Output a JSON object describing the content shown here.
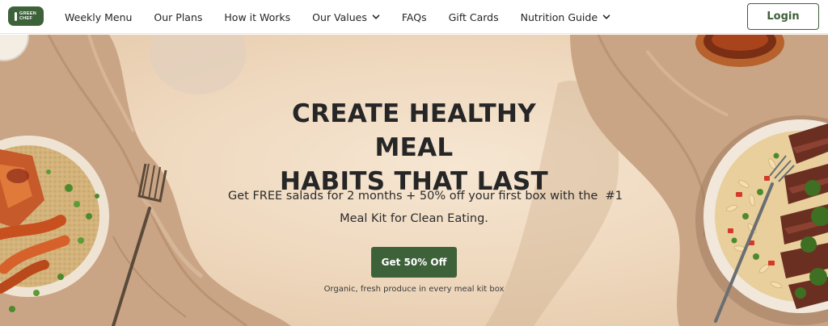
{
  "brand": {
    "logo_text": "GREEN CHEF",
    "logo_color": "#3d6139"
  },
  "nav": {
    "items": [
      {
        "label": "Weekly Menu",
        "dropdown": false
      },
      {
        "label": "Our Plans",
        "dropdown": false
      },
      {
        "label": "How it Works",
        "dropdown": false
      },
      {
        "label": "Our Values",
        "dropdown": true
      },
      {
        "label": "FAQs",
        "dropdown": false
      },
      {
        "label": "Gift Cards",
        "dropdown": false
      },
      {
        "label": "Nutrition Guide",
        "dropdown": true
      }
    ],
    "login_label": "Login"
  },
  "hero": {
    "headline_line1": "CREATE HEALTHY MEAL",
    "headline_line2": "HABITS THAT LAST",
    "subtext_line1": "Get FREE salads for 2 months + 50% off your first box with the  #1",
    "subtext_line2": "Meal Kit for Clean Eating.",
    "cta_label": "Get 50% Off",
    "caption": "Organic, fresh produce in every meal kit box"
  },
  "colors": {
    "accent": "#3d6139",
    "hero_background": "#efd9bf",
    "text": "#262626"
  },
  "icons": {
    "dropdown": "chevron-down-icon"
  }
}
